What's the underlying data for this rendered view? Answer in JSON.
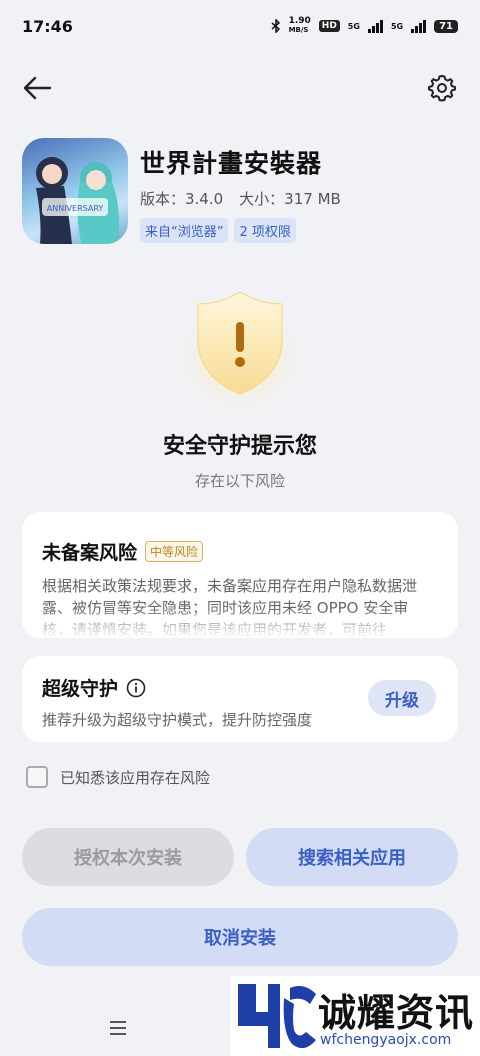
{
  "status_bar": {
    "time": "17:46",
    "speed_value": "1.90",
    "speed_unit": "MB/S",
    "hd_label": "HD",
    "net1": "5G",
    "net2": "5G",
    "battery": "71"
  },
  "nav": {
    "back_icon": "arrow-left-icon",
    "settings_icon": "gear-icon"
  },
  "app": {
    "name": "世界計畫安裝器",
    "version": "版本：3.4.0",
    "size": "大小：317 MB",
    "tags": [
      "来自“浏览器”",
      "2 项权限"
    ]
  },
  "shield": {
    "title": "安全守护提示您",
    "subtitle": "存在以下风险"
  },
  "risk_card": {
    "title": "未备案风险",
    "badge": "中等风险",
    "description": "根据相关政策法规要求，未备案应用存在用户隐私数据泄露、被仿冒等安全隐患；同时该应用未经 OPPO 安全审核，请谨慎安装。如果您是该应用的开发者，可前往"
  },
  "guard_card": {
    "title": "超级守护",
    "description": "推荐升级为超级守护模式，提升防控强度",
    "upgrade_label": "升级"
  },
  "acknowledge": {
    "label": "已知悉该应用存在风险",
    "checked": false
  },
  "buttons": {
    "authorize": "授权本次安装",
    "search": "搜索相关应用",
    "cancel": "取消安装"
  },
  "watermark": {
    "title": "诚耀资讯",
    "url": "wfchengyaojx.com"
  },
  "colors": {
    "accent": "#3a5fc5",
    "background": "#f1f2f6",
    "risk": "#b8862a"
  }
}
